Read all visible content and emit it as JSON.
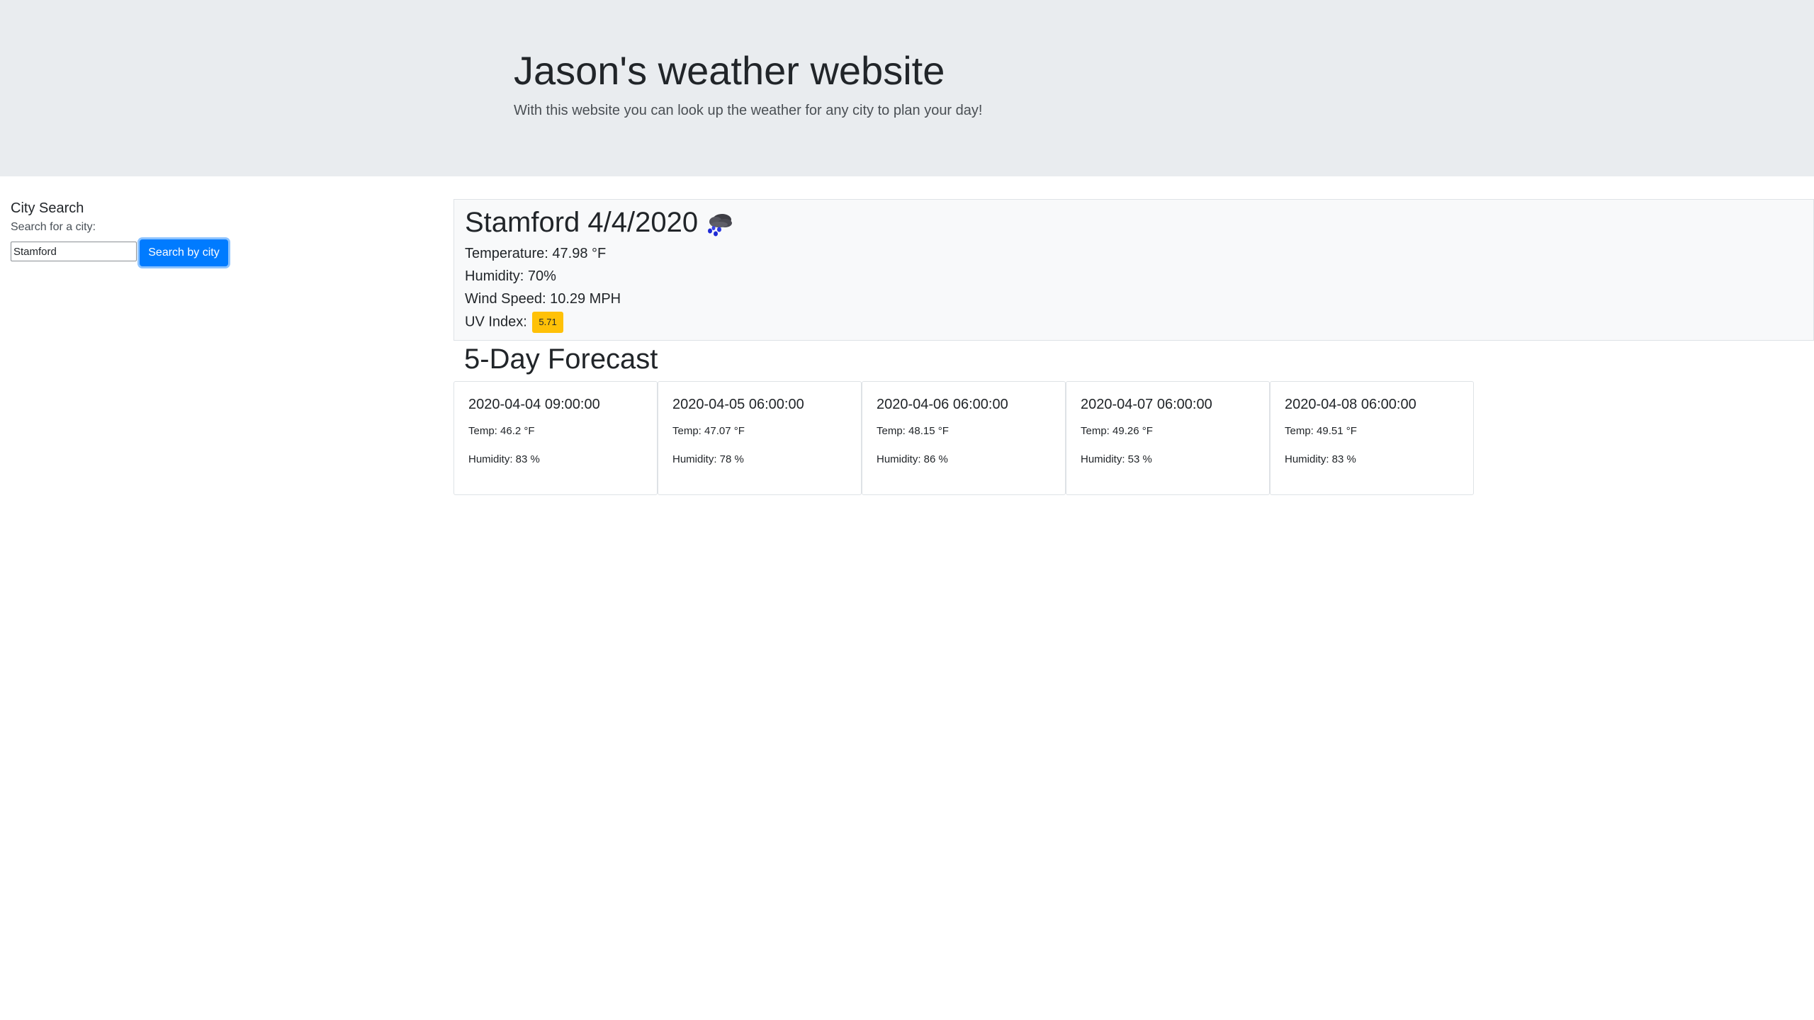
{
  "header": {
    "title": "Jason's weather website",
    "subtitle": "With this website you can look up the weather for any city to plan your day!"
  },
  "sidebar": {
    "title": "City Search",
    "label": "Search for a city:",
    "input_value": "Stamford",
    "button_label": "Search by city"
  },
  "current": {
    "title": "Stamford 4/4/2020",
    "icon": "rain-cloud-icon",
    "temperature": "Temperature: 47.98 °F",
    "humidity": "Humidity: 70%",
    "wind": "Wind Speed: 10.29 MPH",
    "uv_label": "UV Index:",
    "uv_value": "5.71",
    "uv_color": "#ffc107"
  },
  "forecast": {
    "heading": "5-Day Forecast",
    "days": [
      {
        "date": "2020-04-04 09:00:00",
        "temp": "Temp: 46.2 °F",
        "humidity": "Humidity: 83 %"
      },
      {
        "date": "2020-04-05 06:00:00",
        "temp": "Temp: 47.07 °F",
        "humidity": "Humidity: 78 %"
      },
      {
        "date": "2020-04-06 06:00:00",
        "temp": "Temp: 48.15 °F",
        "humidity": "Humidity: 86 %"
      },
      {
        "date": "2020-04-07 06:00:00",
        "temp": "Temp: 49.26 °F",
        "humidity": "Humidity: 53 %"
      },
      {
        "date": "2020-04-08 06:00:00",
        "temp": "Temp: 49.51 °F",
        "humidity": "Humidity: 83 %"
      }
    ]
  },
  "colors": {
    "accent": "#007bff",
    "jumbotron": "#e9ecef",
    "card_bg": "#f8f9fa"
  }
}
